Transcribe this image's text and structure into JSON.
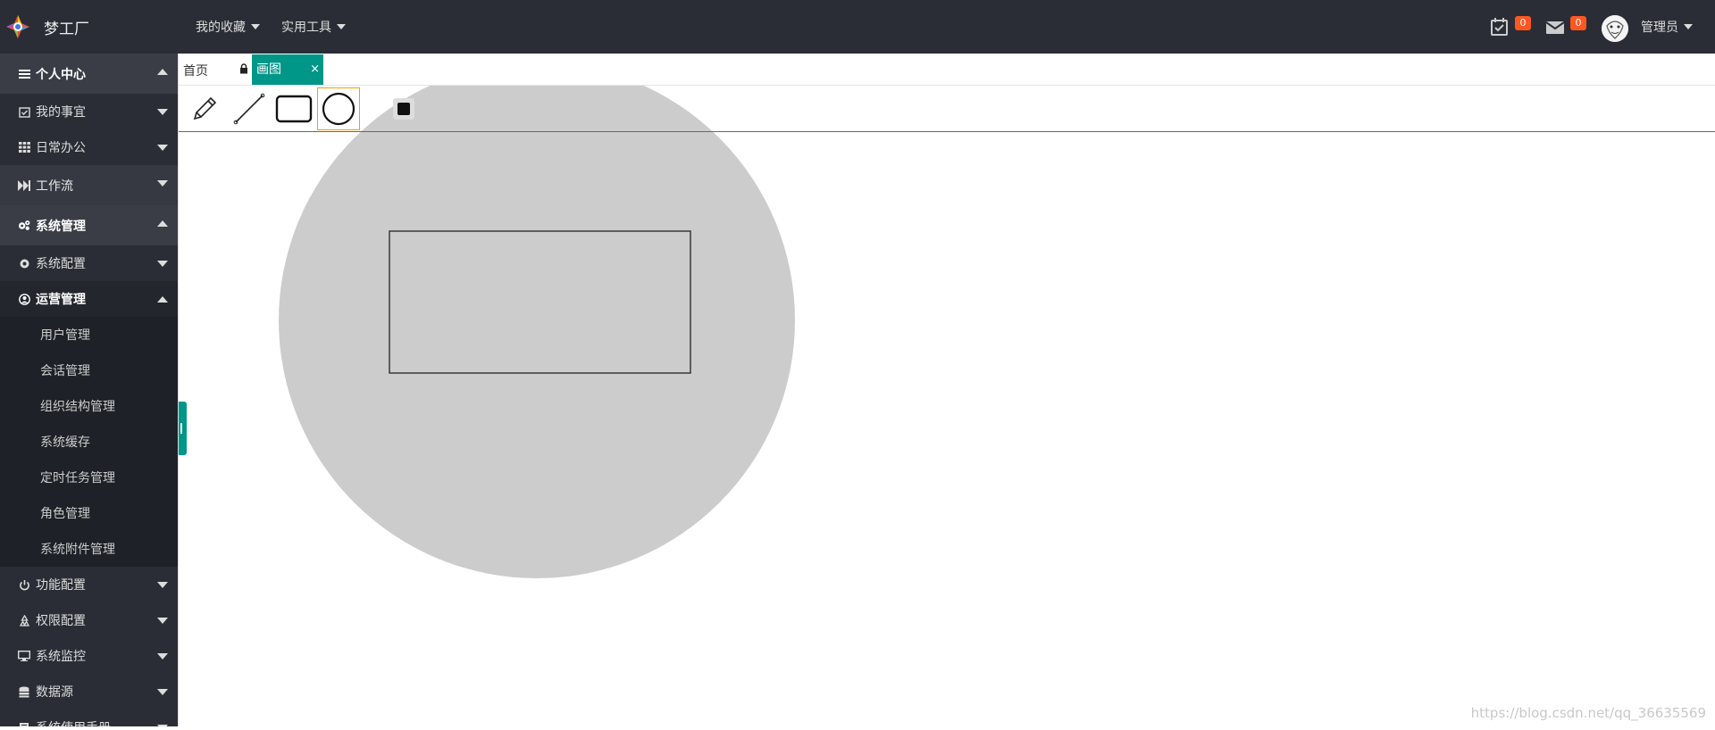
{
  "app": {
    "brand": "梦工厂"
  },
  "topnav": [
    {
      "label": "我的收藏"
    },
    {
      "label": "实用工具"
    }
  ],
  "notifications": {
    "todo_count": "0",
    "mail_count": "0"
  },
  "user": {
    "name": "管理员"
  },
  "sidebar": {
    "items": [
      {
        "label": "个人中心",
        "icon": "bars-icon"
      },
      {
        "label": "我的事宜",
        "icon": "calendar-check-icon"
      },
      {
        "label": "日常办公",
        "icon": "grid-icon"
      },
      {
        "label": "工作流",
        "icon": "fast-forward-icon"
      },
      {
        "label": "系统管理",
        "icon": "gears-icon"
      },
      {
        "label": "系统配置",
        "icon": "gear-icon"
      },
      {
        "label": "运营管理",
        "icon": "user-circle-icon"
      },
      {
        "label": "用户管理"
      },
      {
        "label": "会话管理"
      },
      {
        "label": "组织结构管理"
      },
      {
        "label": "系统缓存"
      },
      {
        "label": "定时任务管理"
      },
      {
        "label": "角色管理"
      },
      {
        "label": "系统附件管理"
      },
      {
        "label": "功能配置",
        "icon": "power-icon"
      },
      {
        "label": "权限配置",
        "icon": "recycle-icon"
      },
      {
        "label": "系统监控",
        "icon": "desktop-icon"
      },
      {
        "label": "数据源",
        "icon": "database-icon"
      },
      {
        "label": "系统使用手册",
        "icon": "book-icon"
      }
    ]
  },
  "tabs": {
    "home": "首页",
    "active": "画图",
    "close": "×"
  },
  "drawing": {
    "tools": [
      "pencil-icon",
      "line-icon",
      "rectangle-icon",
      "circle-icon"
    ],
    "active_tool": "circle-icon",
    "stroke_color": "#111111",
    "shape_fill": "#cccccc"
  },
  "watermark": "https://blog.csdn.net/qq_36635569",
  "colors": {
    "accent": "#009688",
    "header_bg": "#2a2d35",
    "badge": "#ff5722"
  }
}
